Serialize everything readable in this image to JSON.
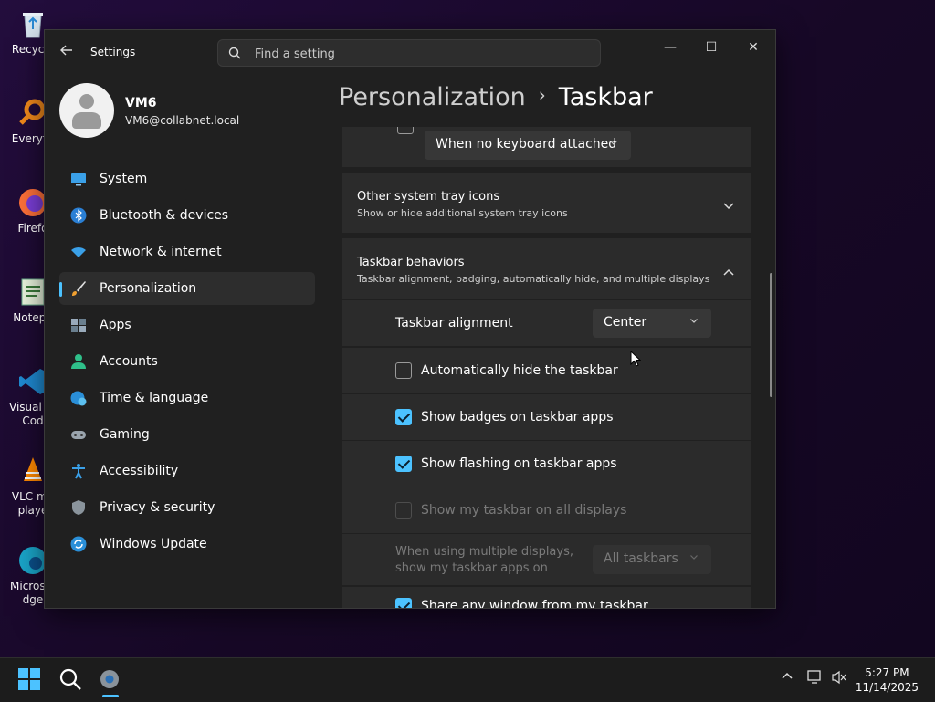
{
  "desktop": {
    "icons": [
      {
        "label": "Recycle",
        "icon": "recycle-bin-icon"
      },
      {
        "label": "Everyth",
        "icon": "everything-icon"
      },
      {
        "label": "Firefo",
        "icon": "firefox-icon"
      },
      {
        "label": "Notepa",
        "icon": "notepad-icon"
      },
      {
        "label": "Visual St Cod",
        "icon": "vscode-icon"
      },
      {
        "label": "VLC me playe",
        "icon": "vlc-icon"
      },
      {
        "label": "Micros Edge",
        "icon": "edge-icon"
      }
    ]
  },
  "window": {
    "app_title": "Settings",
    "search_placeholder": "Find a setting",
    "controls": {
      "minimize": "—",
      "maximize": "☐",
      "close": "✕"
    }
  },
  "user": {
    "name": "VM6",
    "email": "VM6@collabnet.local"
  },
  "sidebar": {
    "items": [
      {
        "label": "System",
        "icon": "system-icon"
      },
      {
        "label": "Bluetooth & devices",
        "icon": "bluetooth-icon"
      },
      {
        "label": "Network & internet",
        "icon": "wifi-icon"
      },
      {
        "label": "Personalization",
        "icon": "brush-icon",
        "selected": true
      },
      {
        "label": "Apps",
        "icon": "apps-icon"
      },
      {
        "label": "Accounts",
        "icon": "accounts-icon"
      },
      {
        "label": "Time & language",
        "icon": "globe-clock-icon"
      },
      {
        "label": "Gaming",
        "icon": "gamepad-icon"
      },
      {
        "label": "Accessibility",
        "icon": "accessibility-icon"
      },
      {
        "label": "Privacy & security",
        "icon": "shield-icon"
      },
      {
        "label": "Windows Update",
        "icon": "update-icon"
      }
    ]
  },
  "breadcrumb": {
    "parent": "Personalization",
    "separator": "›",
    "current": "Taskbar"
  },
  "content": {
    "touch_keyboard_dropdown": "When no keyboard attached",
    "tray_icons": {
      "title": "Other system tray icons",
      "subtitle": "Show or hide additional system tray icons",
      "expanded": false
    },
    "behaviors": {
      "title": "Taskbar behaviors",
      "subtitle": "Taskbar alignment, badging, automatically hide, and multiple displays",
      "expanded": true,
      "alignment_label": "Taskbar alignment",
      "alignment_value": "Center",
      "options": [
        {
          "label": "Automatically hide the taskbar",
          "checked": false,
          "disabled": false
        },
        {
          "label": "Show badges on taskbar apps",
          "checked": true,
          "disabled": false
        },
        {
          "label": "Show flashing on taskbar apps",
          "checked": true,
          "disabled": false
        },
        {
          "label": "Show my taskbar on all displays",
          "checked": false,
          "disabled": true
        }
      ],
      "multi_display_label_1": "When using multiple displays,",
      "multi_display_label_2": "show my taskbar apps on",
      "multi_display_value": "All taskbars",
      "share_window_label": "Share any window from my taskbar",
      "share_window_checked": true
    }
  },
  "taskbar": {
    "clock_time": "5:27 PM",
    "clock_date": "11/14/2025",
    "items": [
      "start-icon",
      "search-icon",
      "settings-icon"
    ]
  },
  "colors": {
    "accent": "#4cc2ff",
    "window_bg": "#202020",
    "card_bg": "#2b2b2b"
  }
}
